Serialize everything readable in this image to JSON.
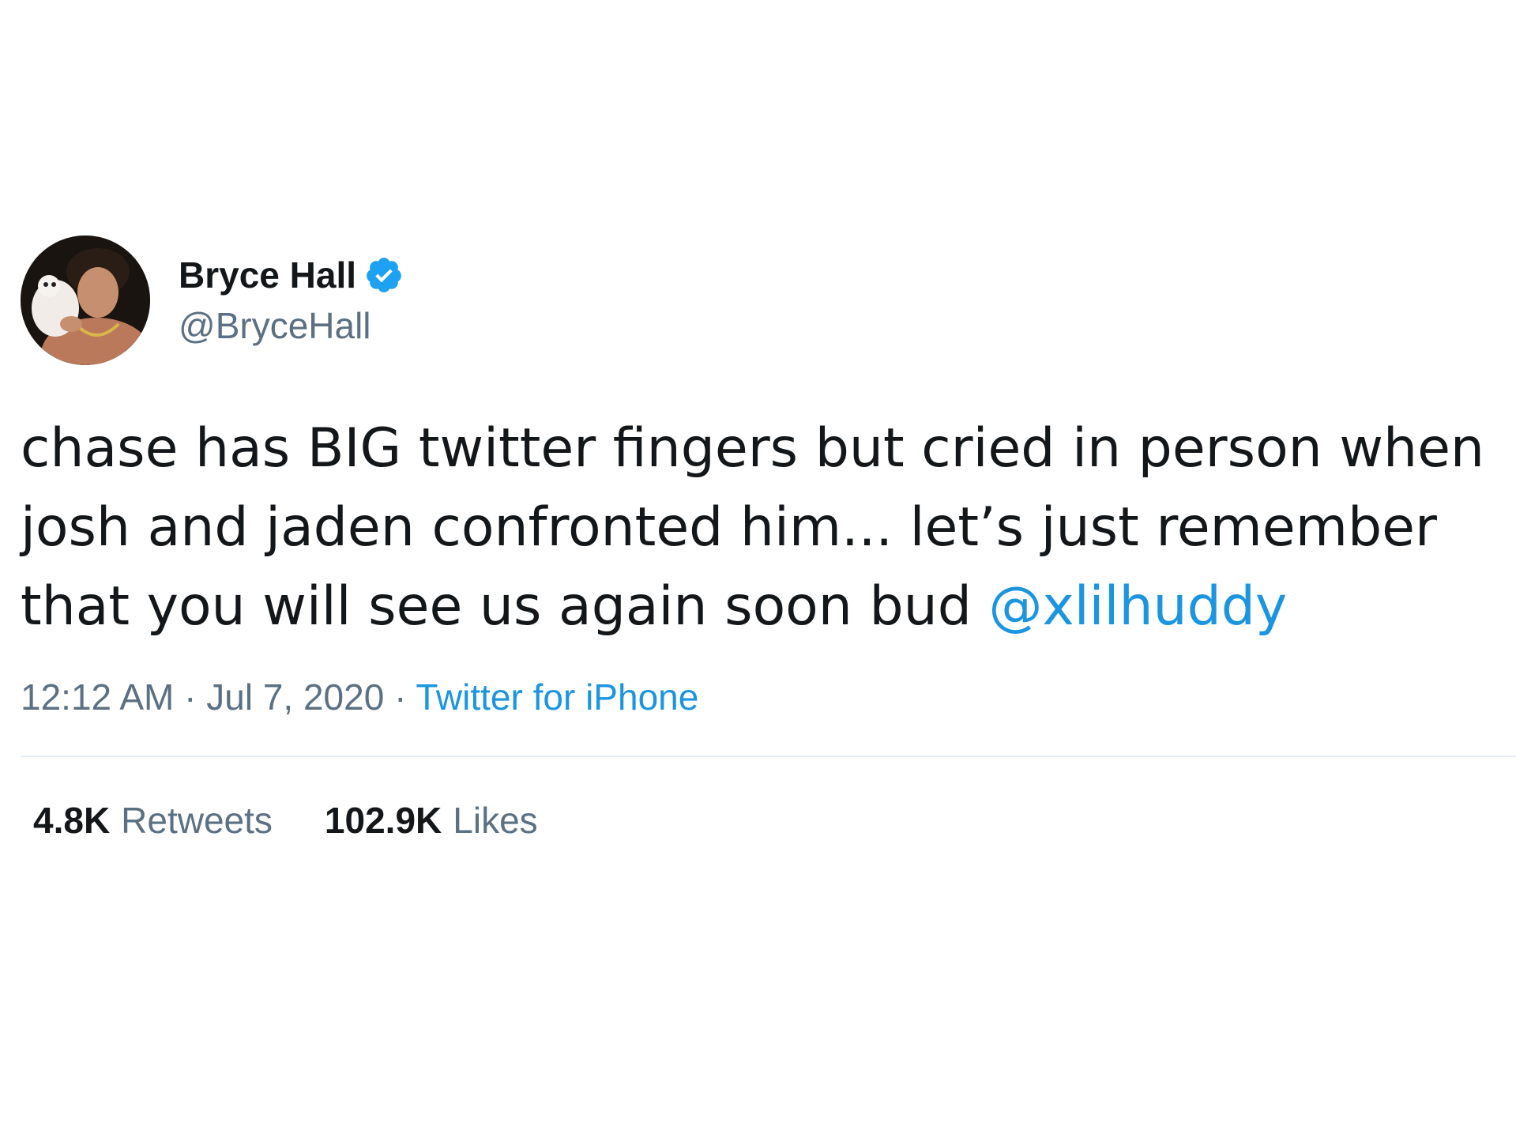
{
  "user": {
    "display_name": "Bryce Hall",
    "handle": "@BryceHall",
    "verified": true,
    "avatar_icon": "profile-photo"
  },
  "tweet": {
    "text_segments": [
      "chase has BIG twitter fingers but cried in person when",
      "josh and jaden confronted him... let’s just remember",
      "that you will see us again soon bud "
    ],
    "mention": "@xlilhuddy",
    "time": "12:12 AM",
    "separator": "·",
    "date": "Jul 7, 2020",
    "source": "Twitter for iPhone"
  },
  "stats": {
    "retweets_count": "4.8K",
    "retweets_label": "Retweets",
    "likes_count": "102.9K",
    "likes_label": "Likes"
  },
  "colors": {
    "link": "#1b95e0",
    "secondary_text": "#5b7083",
    "primary_text": "#14171a",
    "verified": "#1da1f2",
    "divider": "#e6ecf0"
  }
}
